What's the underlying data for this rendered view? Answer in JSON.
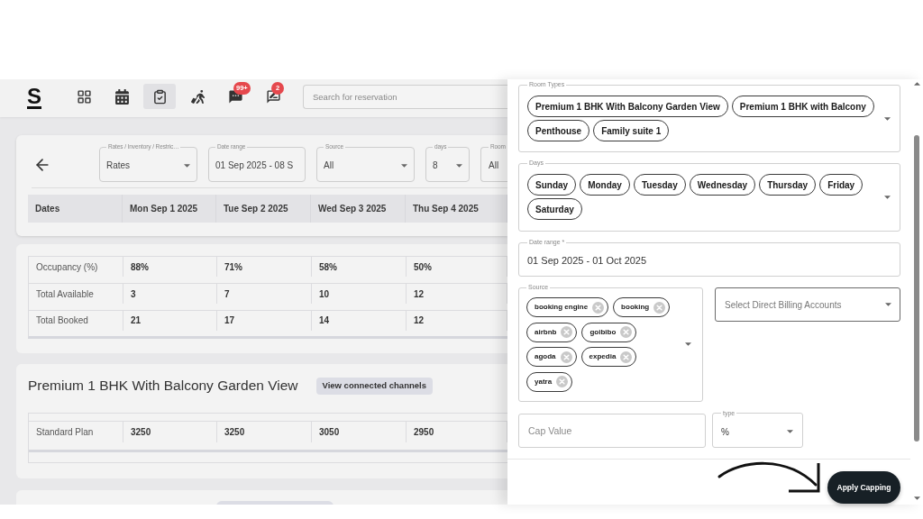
{
  "header": {
    "logo": "S",
    "nav": [
      {
        "selected": false
      },
      {
        "selected": false
      },
      {
        "selected": true
      },
      {
        "selected": false
      },
      {
        "selected": false,
        "badge": "99+"
      },
      {
        "selected": false,
        "badge": "2"
      }
    ],
    "search": {
      "placeholder": "Search for reservation"
    }
  },
  "filters": [
    {
      "kind": "select",
      "label": "Rates / Inventory / Restric…",
      "value": "Rates"
    },
    {
      "kind": "date",
      "label": "Date range",
      "value": "01 Sep 2025 - 08 S"
    },
    {
      "kind": "select",
      "label": "Source",
      "value": "All"
    },
    {
      "kind": "select",
      "label": "days",
      "value": "8"
    },
    {
      "kind": "select",
      "label": "Room",
      "value": "All"
    }
  ],
  "dates_table": {
    "columns": [
      "Dates",
      "Mon Sep 1 2025",
      "Tue Sep 2 2025",
      "Wed Sep 3 2025",
      "Thu Sep 4 2025"
    ]
  },
  "summary_table": {
    "rows": [
      {
        "label": "Occupancy (%)",
        "values": [
          "88%",
          "71%",
          "58%",
          "50%"
        ]
      },
      {
        "label": "Total Available",
        "values": [
          "3",
          "7",
          "10",
          "12"
        ]
      },
      {
        "label": "Total Booked",
        "values": [
          "21",
          "17",
          "14",
          "12"
        ]
      }
    ]
  },
  "room_section": {
    "title": "Premium 1 BHK With Balcony Garden View",
    "button": "View connected channels",
    "rows": [
      {
        "label": "Standard Plan",
        "values": [
          "3250",
          "3250",
          "3050",
          "2950"
        ]
      }
    ]
  },
  "drawer": {
    "room_types": {
      "label": "Room Types",
      "chips": [
        "Premium 1 BHK With Balcony Garden View",
        "Premium 1 BHK with Balcony",
        "Penthouse",
        "Family suite 1"
      ]
    },
    "days": {
      "label": "Days",
      "chips": [
        "Sunday",
        "Monday",
        "Tuesday",
        "Wednesday",
        "Thursday",
        "Friday",
        "Saturday"
      ]
    },
    "date_range": {
      "label": "Date range *",
      "value": "01 Sep 2025 - 01 Oct 2025"
    },
    "source": {
      "label": "Source",
      "chips": [
        "booking engine",
        "booking",
        "airbnb",
        "goibibo",
        "agoda",
        "expedia",
        "yatra"
      ]
    },
    "billing_accounts": {
      "placeholder": "Select Direct Billing Accounts"
    },
    "cap_value": {
      "placeholder": "Cap Value"
    },
    "type": {
      "label": "type",
      "value": "%"
    },
    "apply_button": "Apply Capping"
  }
}
